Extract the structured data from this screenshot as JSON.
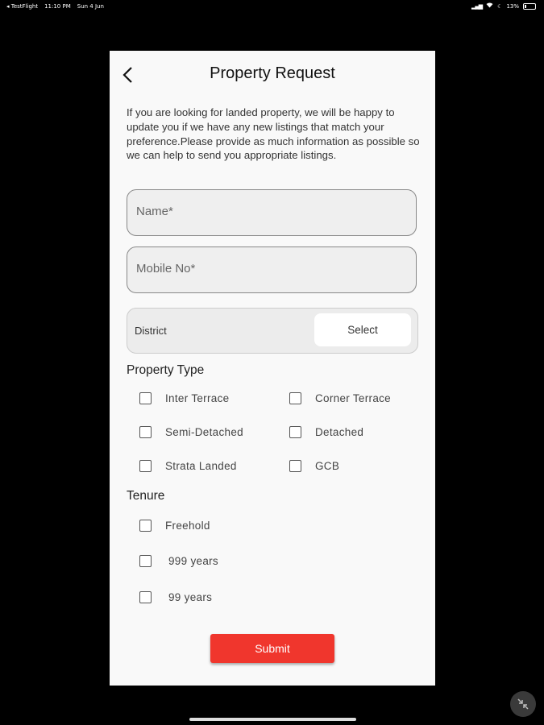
{
  "status_bar": {
    "carrier": "◂ TestFlight",
    "time": "11:10 PM",
    "date": "Sun 4 Jun",
    "battery": "13%"
  },
  "header": {
    "title": "Property Request"
  },
  "intro_text": "If you are looking for landed property, we will be happy to update you if we have any new listings that match your preference.Please provide as much information as possible so we can help to send you appropriate listings.",
  "form": {
    "name_placeholder": "Name*",
    "mobile_placeholder": "Mobile No*",
    "district_label": "District",
    "district_select_label": "Select"
  },
  "property_type": {
    "title": "Property Type",
    "options": [
      "Inter Terrace",
      "Corner Terrace",
      "Semi-Detached",
      "Detached",
      "Strata Landed",
      "GCB"
    ]
  },
  "tenure": {
    "title": "Tenure",
    "options": [
      "Freehold",
      "999 years",
      "99 years"
    ]
  },
  "submit_label": "Submit",
  "colors": {
    "accent": "#f0362d",
    "background": "#000000",
    "card": "#f9f9f9"
  }
}
